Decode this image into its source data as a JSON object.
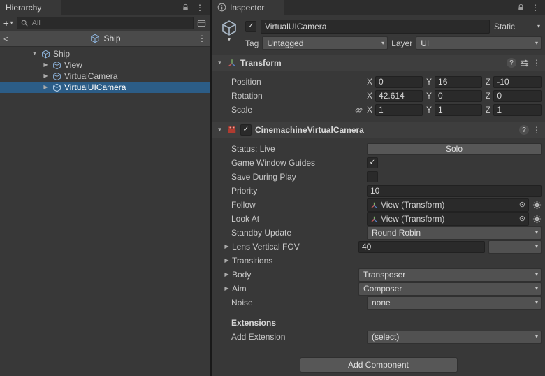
{
  "colors": {
    "selection": "#2C5D87",
    "panel_bg": "#383838",
    "component_header_bg": "#3E3E3E",
    "field_bg": "#2A2A2A",
    "control_bg": "#515151",
    "prefab_icon_blue": "#8FB6DF",
    "cinemachine_icon_red": "#B03B30"
  },
  "icons": {
    "kebab": "⋮",
    "caret": "▾",
    "foldout_open": "▼",
    "foldout_closed": "▶",
    "check": "✓",
    "picker": "⊙",
    "plus": "+",
    "back": "<",
    "help": "?"
  },
  "hierarchy": {
    "tab_label": "Hierarchy",
    "toolbar": {
      "search_placeholder": "All"
    },
    "prefab_header": {
      "name": "Ship"
    },
    "tree": {
      "root": {
        "label": "Ship",
        "expanded": true
      },
      "children": [
        {
          "label": "View",
          "selected": false
        },
        {
          "label": "VirtualCamera",
          "selected": false
        },
        {
          "label": "VirtualUICamera",
          "selected": true
        }
      ]
    }
  },
  "inspector": {
    "tab_label": "Inspector",
    "game_object": {
      "active_checked": true,
      "name": "VirtualUICamera",
      "static_label": "Static",
      "tag_label": "Tag",
      "tag_value": "Untagged",
      "layer_label": "Layer",
      "layer_value": "UI"
    },
    "transform": {
      "title": "Transform",
      "axis_x": "X",
      "axis_y": "Y",
      "axis_z": "Z",
      "position": {
        "label": "Position",
        "x": "0",
        "y": "16",
        "z": "-10"
      },
      "rotation": {
        "label": "Rotation",
        "x": "42.614",
        "y": "0",
        "z": "0"
      },
      "scale": {
        "label": "Scale",
        "x": "1",
        "y": "1",
        "z": "1"
      }
    },
    "cinemachine": {
      "title": "CinemachineVirtualCamera",
      "enabled_checked": true,
      "status": {
        "label": "Status: Live",
        "solo_button": "Solo"
      },
      "game_window_guides": {
        "label": "Game Window Guides",
        "checked": true
      },
      "save_during_play": {
        "label": "Save During Play",
        "checked": false
      },
      "priority": {
        "label": "Priority",
        "value": "10"
      },
      "follow": {
        "label": "Follow",
        "value": "View (Transform)"
      },
      "look_at": {
        "label": "Look At",
        "value": "View (Transform)"
      },
      "standby_update": {
        "label": "Standby Update",
        "value": "Round Robin"
      },
      "lens": {
        "label": "Lens Vertical FOV",
        "value": "40"
      },
      "transitions": {
        "label": "Transitions"
      },
      "body": {
        "label": "Body",
        "value": "Transposer"
      },
      "aim": {
        "label": "Aim",
        "value": "Composer"
      },
      "noise": {
        "label": "Noise",
        "value": "none"
      },
      "extensions_header": "Extensions",
      "add_extension": {
        "label": "Add Extension",
        "value": "(select)"
      }
    },
    "add_component_button": "Add Component"
  }
}
